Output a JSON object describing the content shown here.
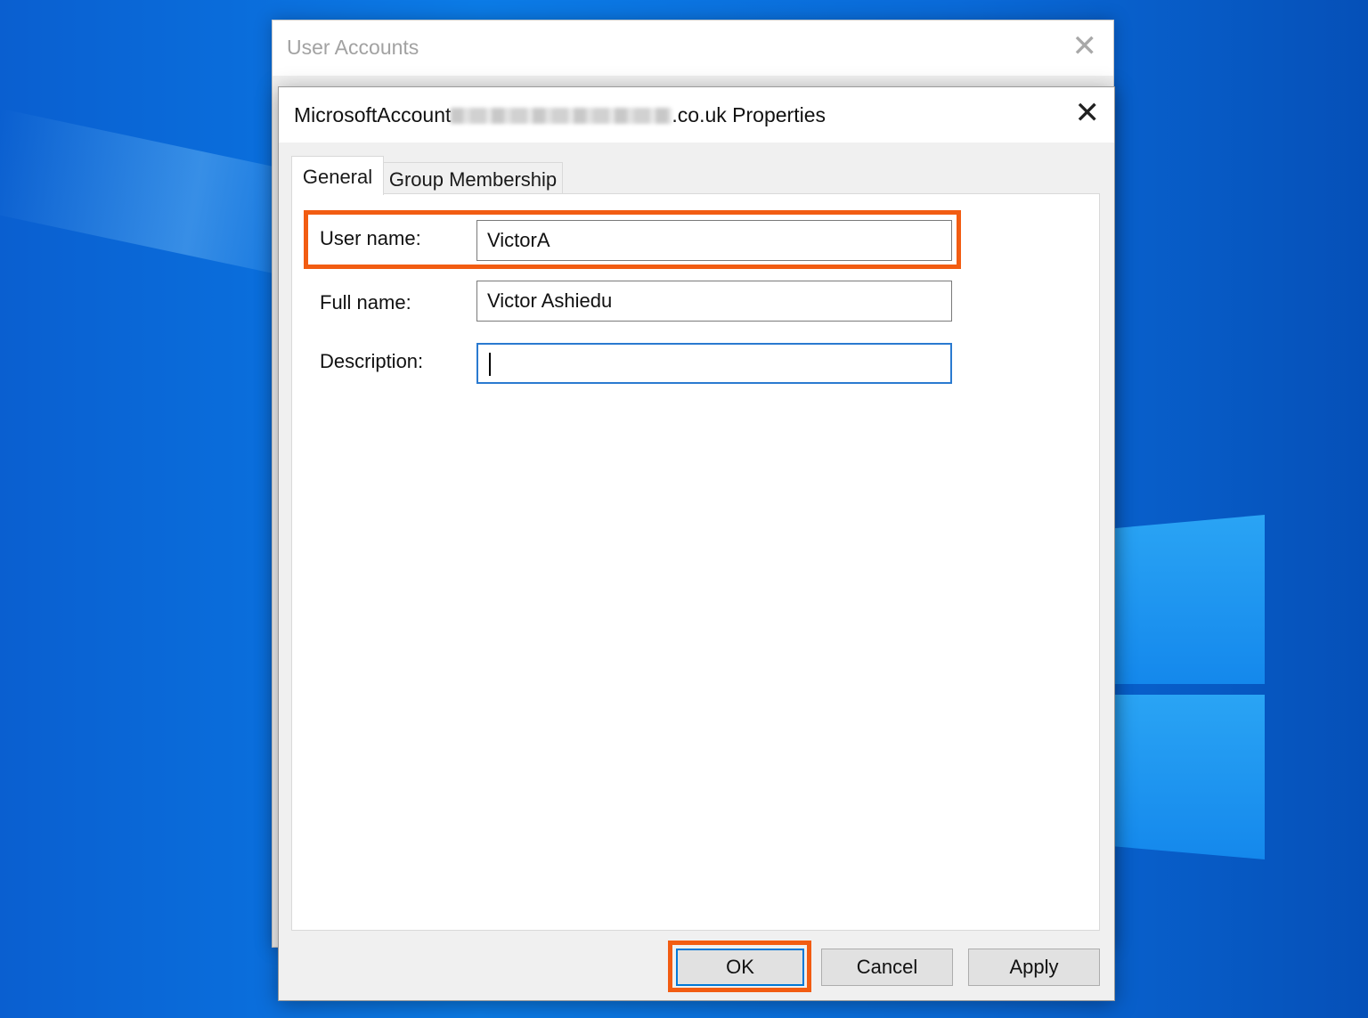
{
  "background_window": {
    "title": "User Accounts",
    "close_glyph": "✕"
  },
  "dialog": {
    "title_prefix": "MicrosoftAccount",
    "title_suffix": ".co.uk Properties",
    "close_glyph": "✕"
  },
  "tabs": [
    {
      "label": "General",
      "selected": true
    },
    {
      "label": "Group Membership",
      "selected": false
    }
  ],
  "form": {
    "user_name": {
      "label": "User name:",
      "value": "VictorA"
    },
    "full_name": {
      "label": "Full name:",
      "value": "Victor Ashiedu"
    },
    "description": {
      "label": "Description:",
      "value": ""
    }
  },
  "buttons": {
    "ok": "OK",
    "cancel": "Cancel",
    "apply": "Apply"
  },
  "colors": {
    "highlight": "#f25c12",
    "focus": "#2a7ad0",
    "desktop": "#0b7be6"
  }
}
